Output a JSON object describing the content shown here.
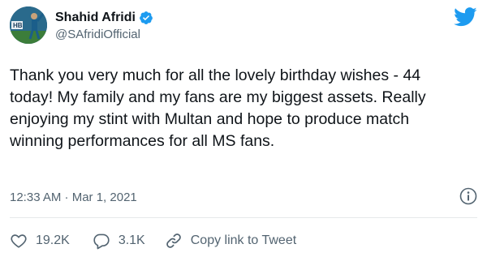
{
  "author": {
    "display_name": "Shahid Afridi",
    "handle": "@SAfridiOfficial",
    "verified": true,
    "avatar_icon": "cricket-player-avatar"
  },
  "tweet": {
    "text": "Thank you very much for all the lovely birthday wishes - 44\ntoday! My family and my fans are my biggest assets. Really\nenjoying my stint with Multan and hope to produce match\nwinning performances for all MS fans.",
    "timestamp": "12:33 AM · Mar 1, 2021"
  },
  "actions": {
    "likes": "19.2K",
    "replies": "3.1K",
    "copy_link_label": "Copy link to Tweet"
  },
  "icons": {
    "brand": "twitter-bird-icon",
    "info": "info-icon",
    "verified": "verified-badge-icon",
    "like": "heart-icon",
    "reply": "speech-bubble-icon",
    "link": "link-icon"
  },
  "colors": {
    "twitter_blue": "#1d9bf0",
    "text_primary": "#0f1419",
    "text_secondary": "#536471"
  }
}
